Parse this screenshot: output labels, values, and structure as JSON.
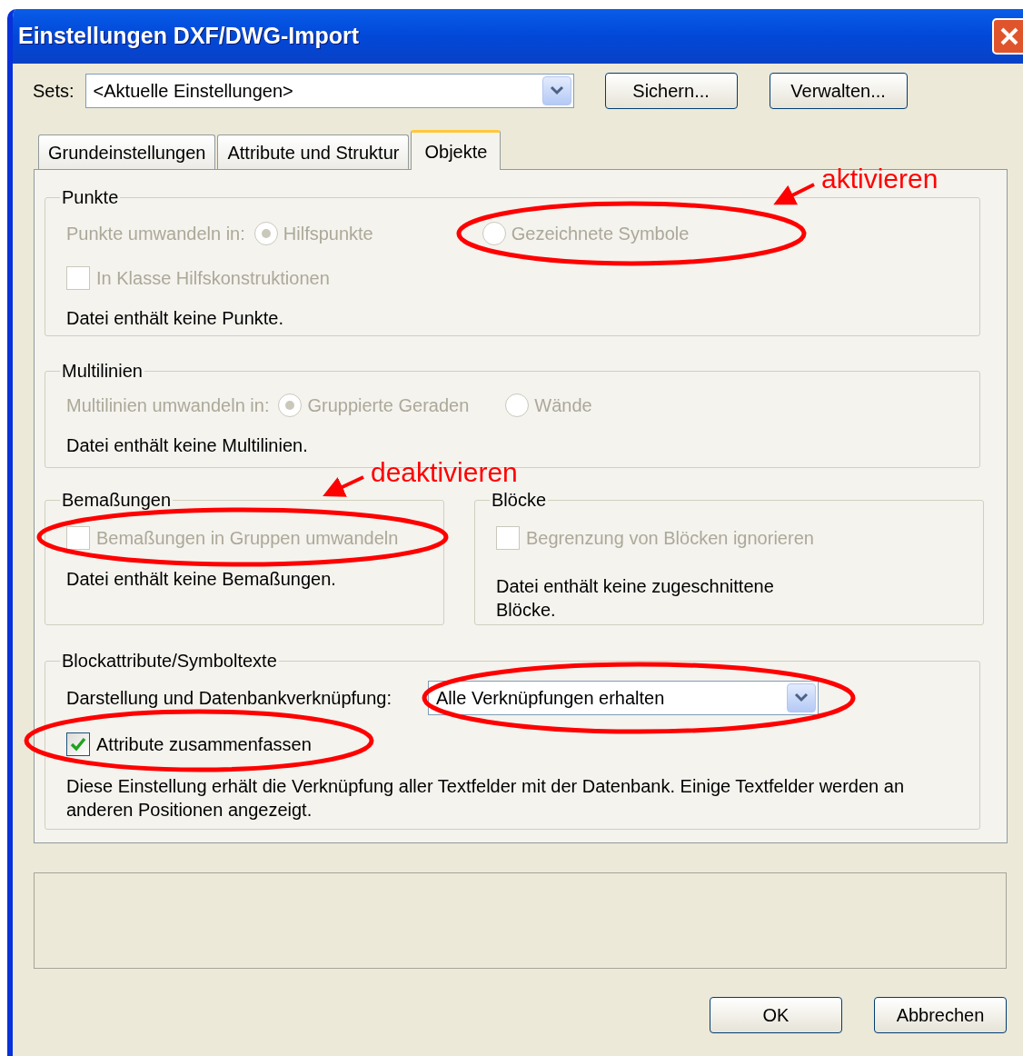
{
  "window": {
    "title": "Einstellungen DXF/DWG-Import"
  },
  "sets": {
    "label": "Sets:",
    "value": "<Aktuelle Einstellungen>"
  },
  "top_buttons": [
    "Sichern...",
    "Verwalten..."
  ],
  "tabs": [
    {
      "label": "Grundeinstellungen",
      "selected": false
    },
    {
      "label": "Attribute und Struktur",
      "selected": false
    },
    {
      "label": "Objekte",
      "selected": true
    }
  ],
  "punkte": {
    "title": "Punkte",
    "convert_label": "Punkte umwandeln in:",
    "disabled": true,
    "options": [
      {
        "label": "Hilfspunkte",
        "selected": true
      },
      {
        "label": "Gezeichnete Symbole",
        "selected": false
      }
    ],
    "checkbox": {
      "label": "In Klasse Hilfskonstruktionen",
      "checked": false
    },
    "note": "Datei enthält keine Punkte."
  },
  "multilinien": {
    "title": "Multilinien",
    "convert_label": "Multilinien umwandeln in:",
    "disabled": true,
    "options": [
      {
        "label": "Gruppierte Geraden",
        "selected": true
      },
      {
        "label": "Wände",
        "selected": false
      }
    ],
    "note": "Datei enthält keine Multilinien."
  },
  "bemassungen": {
    "title": "Bemaßungen",
    "disabled": true,
    "checkbox": {
      "label": "Bemaßungen in Gruppen umwandeln",
      "checked": false
    },
    "note": "Datei enthält keine Bemaßungen."
  },
  "bloecke": {
    "title": "Blöcke",
    "disabled": true,
    "checkbox": {
      "label": "Begrenzung von Blöcken ignorieren",
      "checked": false
    },
    "note": "Datei enthält keine zugeschnittene Blöcke."
  },
  "blockattribute": {
    "title": "Blockattribute/Symboltexte",
    "link_label": "Darstellung und Datenbankverknüpfung:",
    "link_value": "Alle Verknüpfungen erhalten",
    "disabled": false,
    "checkbox": {
      "label": "Attribute zusammenfassen",
      "checked": true
    },
    "note": "Diese Einstellung erhält die Verknüpfung aller Textfelder mit der Datenbank. Einige Textfelder werden an anderen Positionen angezeigt."
  },
  "bottom_buttons": [
    "OK",
    "Abbrechen"
  ],
  "annotations": [
    {
      "text": "aktivieren"
    },
    {
      "text": "deaktivieren"
    }
  ]
}
